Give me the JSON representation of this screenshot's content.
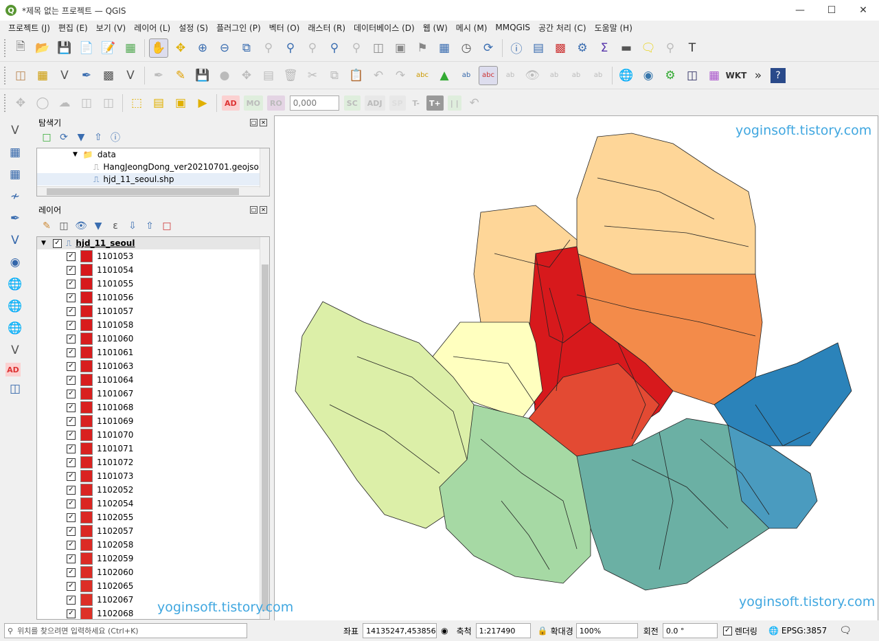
{
  "window": {
    "title": "*제목 없는 프로젝트 — QGIS",
    "logo": "Q"
  },
  "menu": [
    "프로젝트 (J)",
    "편집 (E)",
    "보기 (V)",
    "레이어 (L)",
    "설정 (S)",
    "플러그인 (P)",
    "벡터 (O)",
    "래스터 (R)",
    "데이터베이스 (D)",
    "웹 (W)",
    "메시 (M)",
    "MMQGIS",
    "공간 처리 (C)",
    "도움말 (H)"
  ],
  "toolbar3": {
    "ad": "AD",
    "mo": "MO",
    "ro": "RO",
    "num": "0,000",
    "sc": "SC",
    "adj": "ADJ",
    "sp": "SP",
    "tminus": "T-",
    "tplus": "T+"
  },
  "browser": {
    "title": "탐색기",
    "items": [
      {
        "label": "data"
      },
      {
        "label": "HangJeongDong_ver20210701.geojson"
      },
      {
        "label": "hjd_11_seoul.shp"
      }
    ]
  },
  "layers": {
    "title": "레이어",
    "group": "hjd_11_seoul",
    "items": [
      {
        "label": "1101053",
        "color": "#d7191c"
      },
      {
        "label": "1101054",
        "color": "#d7191c"
      },
      {
        "label": "1101055",
        "color": "#d7191c"
      },
      {
        "label": "1101056",
        "color": "#d7191c"
      },
      {
        "label": "1101057",
        "color": "#d81c1d"
      },
      {
        "label": "1101058",
        "color": "#d81c1d"
      },
      {
        "label": "1101060",
        "color": "#d81d1e"
      },
      {
        "label": "1101061",
        "color": "#d81d1e"
      },
      {
        "label": "1101063",
        "color": "#d81e1e"
      },
      {
        "label": "1101064",
        "color": "#d81e1e"
      },
      {
        "label": "1101067",
        "color": "#d9201f"
      },
      {
        "label": "1101068",
        "color": "#d9201f"
      },
      {
        "label": "1101069",
        "color": "#d92120"
      },
      {
        "label": "1101070",
        "color": "#d92120"
      },
      {
        "label": "1101071",
        "color": "#d92220"
      },
      {
        "label": "1101072",
        "color": "#da2321"
      },
      {
        "label": "1101073",
        "color": "#da2321"
      },
      {
        "label": "1102052",
        "color": "#da2522"
      },
      {
        "label": "1102054",
        "color": "#db2622"
      },
      {
        "label": "1102055",
        "color": "#db2723"
      },
      {
        "label": "1102057",
        "color": "#db2823"
      },
      {
        "label": "1102058",
        "color": "#dc2a24"
      },
      {
        "label": "1102059",
        "color": "#dc2b25"
      },
      {
        "label": "1102060",
        "color": "#dc2c25"
      },
      {
        "label": "1102065",
        "color": "#dd2e26"
      },
      {
        "label": "1102067",
        "color": "#dd2f26"
      },
      {
        "label": "1102068",
        "color": "#de3127"
      }
    ]
  },
  "watermark": "yoginsoft.tistory.com",
  "status": {
    "locator_placeholder": "위치를 찾으려면 입력하세요 (Ctrl+K)",
    "coord_label": "좌표",
    "coord_value": "14135247,4538561",
    "scale_label": "축척",
    "scale_value": "1:217490",
    "magnifier_label": "확대경",
    "magnifier_value": "100%",
    "rotation_label": "회전",
    "rotation_value": "0.0 °",
    "render_label": "렌더링",
    "crs": "EPSG:3857"
  },
  "map_colors": {
    "north_light": "#fed698",
    "north_mid": "#fdae61",
    "north_orange": "#f38b4a",
    "center_red": "#d7191c",
    "center_red2": "#e34a33",
    "west_yellow": "#ffffbf",
    "west_green": "#dcefa8",
    "south_green": "#a6d9a4",
    "south_teal": "#6bb0a4",
    "east_blue": "#2b83ba",
    "east_teal": "#4a9bbf"
  }
}
